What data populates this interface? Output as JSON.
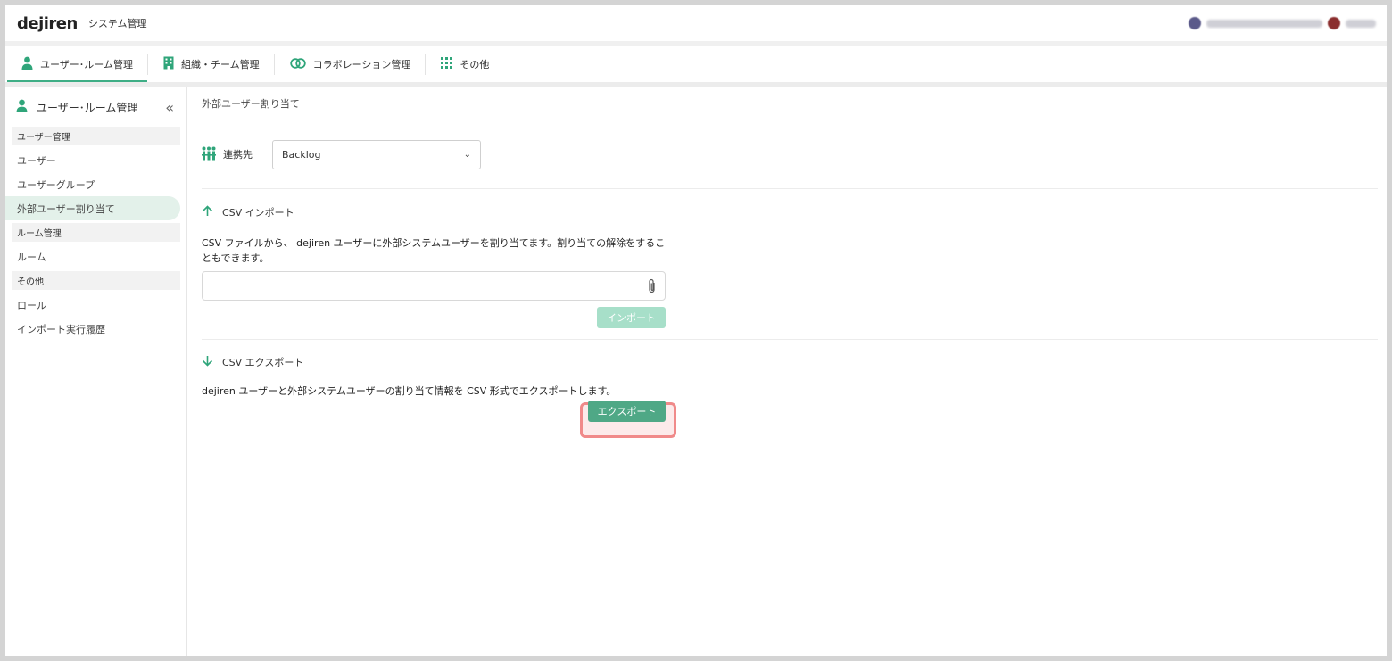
{
  "header": {
    "logo": "dejiren",
    "app_title": "システム管理"
  },
  "tabs": [
    {
      "label": "ユーザー･ルーム管理",
      "icon": "person-icon",
      "active": true
    },
    {
      "label": "組織・チーム管理",
      "icon": "building-icon",
      "active": false
    },
    {
      "label": "コラボレーション管理",
      "icon": "link-icon",
      "active": false
    },
    {
      "label": "その他",
      "icon": "grid-icon",
      "active": false
    }
  ],
  "sidebar": {
    "title": "ユーザー･ルーム管理",
    "collapse_icon": "«",
    "sections": [
      {
        "label": "ユーザー管理",
        "items": [
          "ユーザー",
          "ユーザーグループ",
          "外部ユーザー割り当て"
        ]
      },
      {
        "label": "ルーム管理",
        "items": [
          "ルーム"
        ]
      },
      {
        "label": "その他",
        "items": [
          "ロール",
          "インポート実行履歴"
        ]
      }
    ],
    "active_item": "外部ユーザー割り当て"
  },
  "main": {
    "breadcrumb": "外部ユーザー割り当て",
    "connection": {
      "label": "連携先",
      "selected": "Backlog"
    },
    "import": {
      "title": "CSV インポート",
      "description": "CSV ファイルから、 dejiren ユーザーに外部システムユーザーを割り当てます。割り当ての解除をすることもできます。",
      "button": "インポート"
    },
    "export": {
      "title": "CSV エクスポート",
      "description": "dejiren ユーザーと外部システムユーザーの割り当て情報を CSV 形式でエクスポートします。",
      "button": "エクスポート"
    }
  },
  "colors": {
    "accent": "#3fae86",
    "export_button": "#4fa886",
    "import_button_disabled": "#a7dfc9",
    "highlight": "#f08a8a"
  }
}
